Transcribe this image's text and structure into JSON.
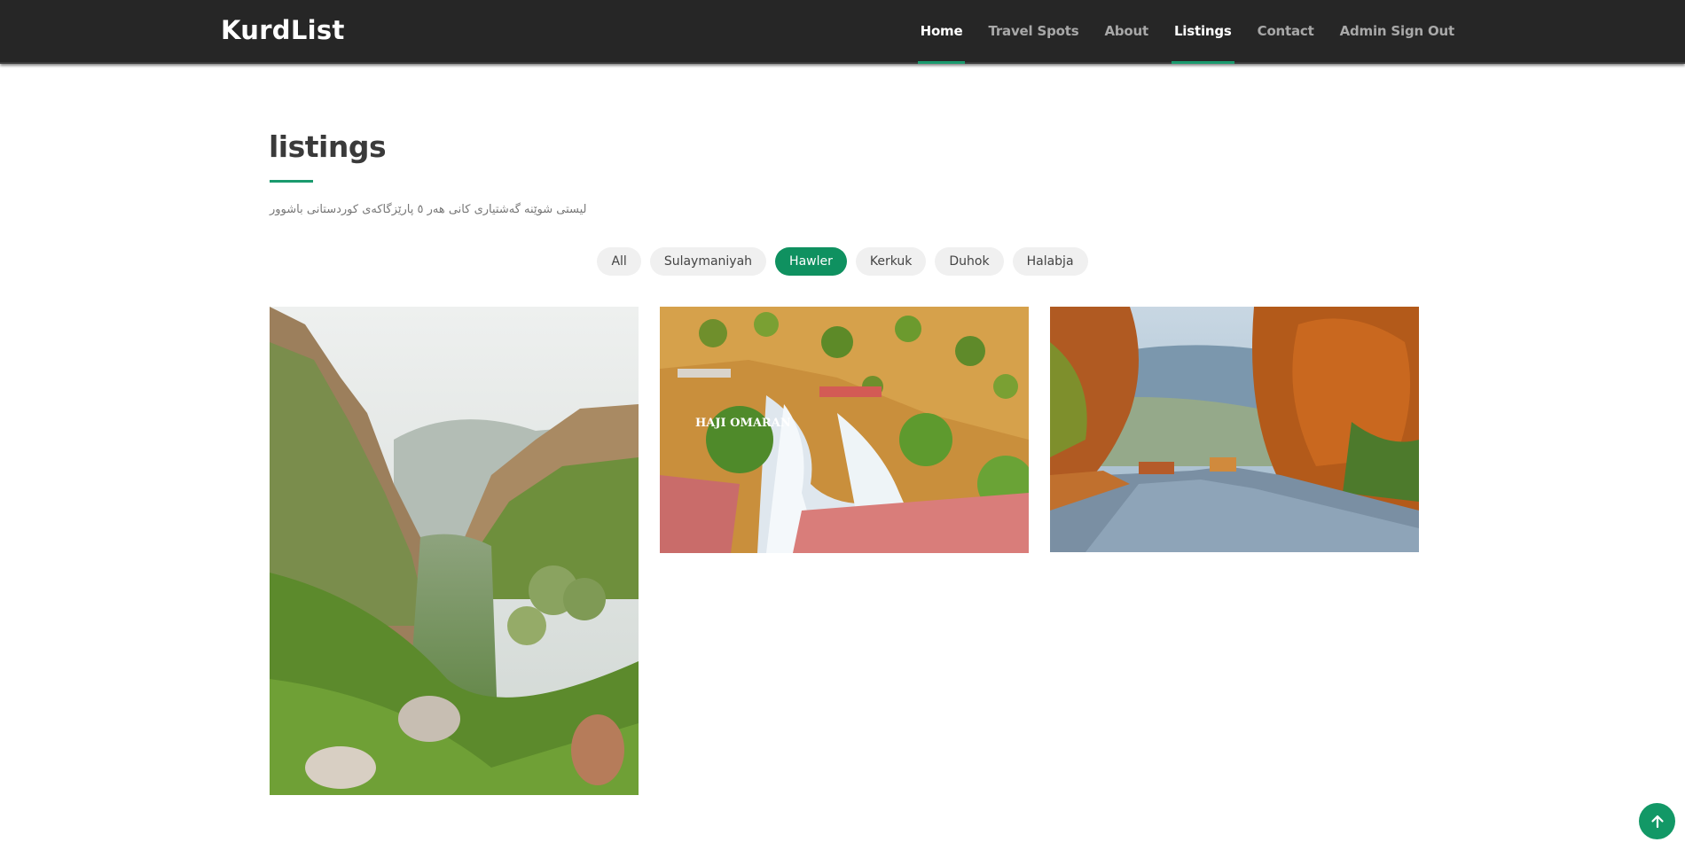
{
  "header": {
    "logo": "KurdList",
    "nav": [
      {
        "label": "Home",
        "active": true
      },
      {
        "label": "Travel Spots",
        "active": false
      },
      {
        "label": "About",
        "active": false
      },
      {
        "label": "Listings",
        "active": true
      },
      {
        "label": "Contact",
        "active": false
      },
      {
        "label": "Admin Sign Out",
        "active": false
      }
    ]
  },
  "section": {
    "title": "listings",
    "subtitle": "لیستی شوێنە گەشتیاری کانی هەر ٥ پارێزگاکەی کوردستانی باشوور"
  },
  "filters": [
    {
      "label": "All",
      "active": false
    },
    {
      "label": "Sulaymaniyah",
      "active": false
    },
    {
      "label": "Hawler",
      "active": true
    },
    {
      "label": "Kerkuk",
      "active": false
    },
    {
      "label": "Duhok",
      "active": false
    },
    {
      "label": "Halabja",
      "active": false
    }
  ],
  "cards": [
    {
      "name": "canyon-photo"
    },
    {
      "name": "waterfall-photo",
      "watermark": "HAJI OMARAN"
    },
    {
      "name": "autumn-road-photo"
    }
  ],
  "colors": {
    "accent": "#0f9160",
    "header_bg": "#262626"
  },
  "icons": {
    "scroll_top": "arrow-up-icon"
  }
}
